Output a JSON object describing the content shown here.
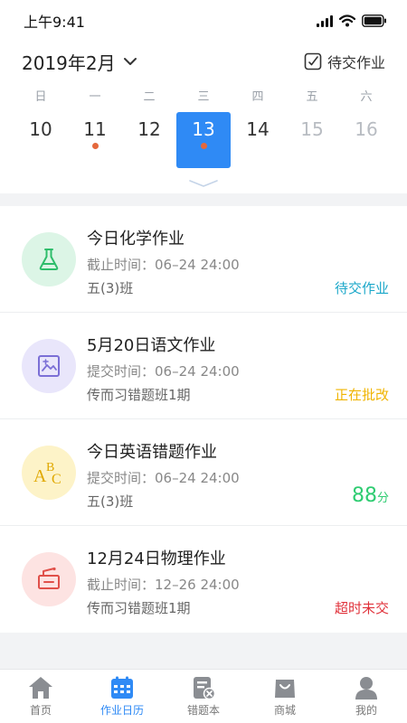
{
  "status_bar": {
    "time": "上午9:41"
  },
  "header": {
    "month": "2019年2月",
    "pending_label": "待交作业"
  },
  "calendar": {
    "weekdays": [
      "日",
      "一",
      "二",
      "三",
      "四",
      "五",
      "六"
    ],
    "days": [
      {
        "num": "10",
        "has_dot": false,
        "selected": false,
        "faded": false
      },
      {
        "num": "11",
        "has_dot": true,
        "selected": false,
        "faded": false
      },
      {
        "num": "12",
        "has_dot": false,
        "selected": false,
        "faded": false
      },
      {
        "num": "13",
        "has_dot": true,
        "selected": true,
        "faded": false
      },
      {
        "num": "14",
        "has_dot": false,
        "selected": false,
        "faded": false
      },
      {
        "num": "15",
        "has_dot": false,
        "selected": false,
        "faded": true
      },
      {
        "num": "16",
        "has_dot": false,
        "selected": false,
        "faded": true
      }
    ]
  },
  "homework": [
    {
      "title": "今日化学作业",
      "time": "截止时间：06–24 24:00",
      "class": "五(3)班",
      "status": "待交作业",
      "status_color": "#1aa7c9",
      "icon": "flask-icon",
      "icon_bg": "#dcf5e6"
    },
    {
      "title": "5月20日语文作业",
      "time": "提交时间：06–24 24:00",
      "class": "传而习错题班1期",
      "status": "正在批改",
      "status_color": "#f0b400",
      "icon": "picture-icon",
      "icon_bg": "#e9e6fb"
    },
    {
      "title": "今日英语错题作业",
      "time": "提交时间：06–24 24:00",
      "class": "五(3)班",
      "score": "88",
      "score_unit": "分",
      "score_color": "#2ecc71",
      "icon": "abc-icon",
      "icon_bg": "#fdf3c8"
    },
    {
      "title": "12月24日物理作业",
      "time": "截止时间：12–26 24:00",
      "class": "传而习错题班1期",
      "status": "超时未交",
      "status_color": "#e0313a",
      "icon": "circuit-icon",
      "icon_bg": "#fde3e2"
    }
  ],
  "tabbar": [
    {
      "label": "首页",
      "icon": "home-icon",
      "active": false
    },
    {
      "label": "作业日历",
      "icon": "calendar-icon",
      "active": true
    },
    {
      "label": "错题本",
      "icon": "error-book-icon",
      "active": false
    },
    {
      "label": "商城",
      "icon": "shop-bag-icon",
      "active": false
    },
    {
      "label": "我的",
      "icon": "profile-icon",
      "active": false
    }
  ],
  "colors": {
    "accent": "#2f8af5",
    "dot": "#e5683c"
  }
}
